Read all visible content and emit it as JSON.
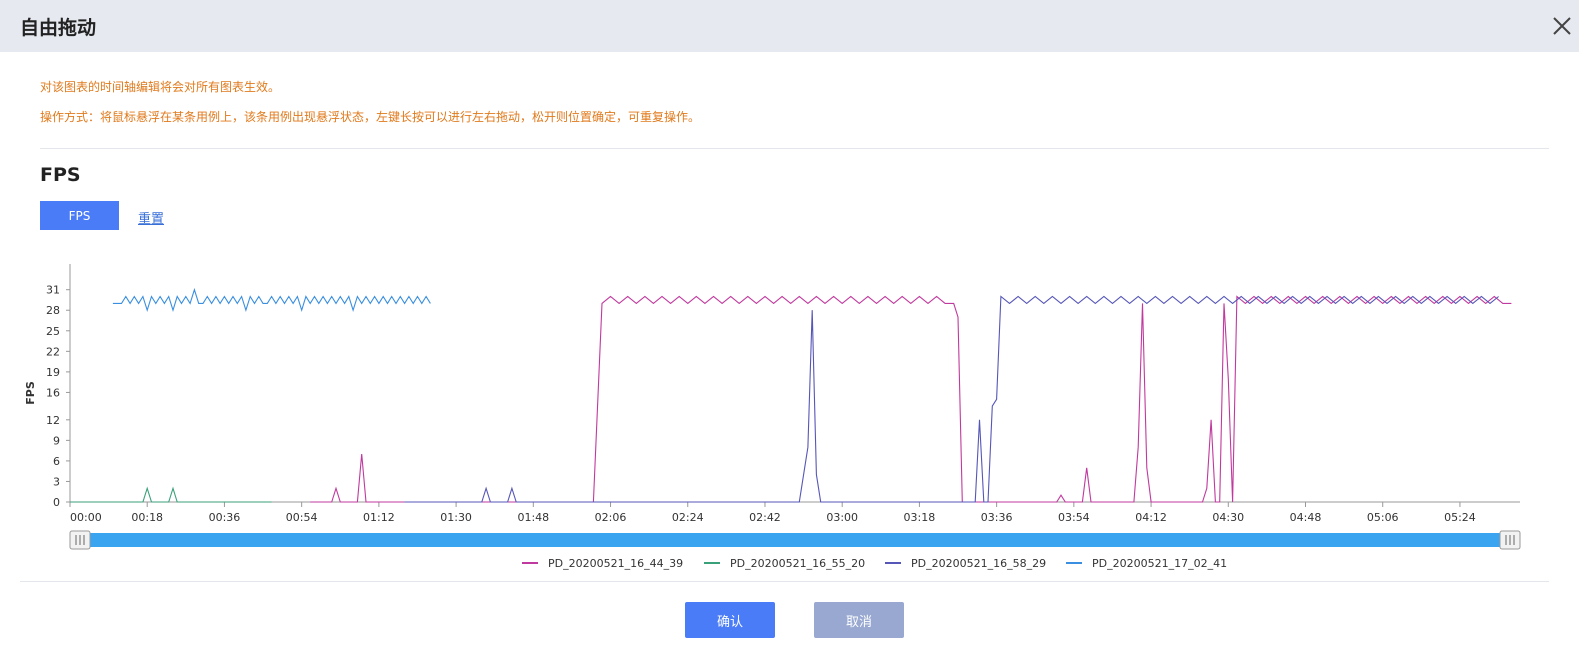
{
  "dialog": {
    "title": "自由拖动",
    "close_icon": "close-icon"
  },
  "notices": {
    "line1": "对该图表的时间轴编辑将会对所有图表生效。",
    "line2": "操作方式：将鼠标悬浮在某条用例上，该条用例出现悬浮状态，左键长按可以进行左右拖动，松开则位置确定，可重复操作。"
  },
  "section": {
    "title": "FPS",
    "tab_label": "FPS",
    "reset_label": "重置"
  },
  "buttons": {
    "confirm": "确认",
    "cancel": "取消"
  },
  "colors": {
    "accent": "#4a7cf7",
    "notice": "#e07a1c",
    "slider": "#3aa4f0"
  },
  "chart_data": {
    "type": "line",
    "ylabel": "FPS",
    "xlabel": "",
    "y_ticks": [
      0,
      3,
      6,
      9,
      12,
      16,
      19,
      22,
      25,
      28,
      31
    ],
    "ylim": [
      0,
      33
    ],
    "x_ticks": [
      "00:00",
      "00:18",
      "00:36",
      "00:54",
      "01:12",
      "01:30",
      "01:48",
      "02:06",
      "02:24",
      "02:42",
      "03:00",
      "03:18",
      "03:36",
      "03:54",
      "04:12",
      "04:30",
      "04:48",
      "05:06",
      "05:24"
    ],
    "xlim": [
      0,
      338
    ],
    "series": [
      {
        "name": "PD_20200521_16_44_39",
        "color": "#c0399e",
        "points": [
          [
            56,
            0
          ],
          [
            61,
            0
          ],
          [
            62,
            2
          ],
          [
            63,
            0
          ],
          [
            67,
            0
          ],
          [
            68,
            7
          ],
          [
            69,
            0
          ],
          [
            122,
            0
          ],
          [
            124,
            29
          ],
          [
            126,
            30
          ],
          [
            128,
            29
          ],
          [
            130,
            30
          ],
          [
            132,
            29
          ],
          [
            134,
            30
          ],
          [
            136,
            29
          ],
          [
            138,
            30
          ],
          [
            140,
            29
          ],
          [
            142,
            30
          ],
          [
            144,
            29
          ],
          [
            146,
            30
          ],
          [
            148,
            29
          ],
          [
            150,
            30
          ],
          [
            152,
            29
          ],
          [
            154,
            30
          ],
          [
            156,
            29
          ],
          [
            158,
            30
          ],
          [
            160,
            29
          ],
          [
            162,
            30
          ],
          [
            164,
            29
          ],
          [
            166,
            30
          ],
          [
            168,
            29
          ],
          [
            170,
            30
          ],
          [
            172,
            29
          ],
          [
            174,
            30
          ],
          [
            176,
            29
          ],
          [
            178,
            30
          ],
          [
            180,
            29
          ],
          [
            182,
            30
          ],
          [
            184,
            29
          ],
          [
            186,
            30
          ],
          [
            188,
            29
          ],
          [
            190,
            30
          ],
          [
            192,
            29
          ],
          [
            194,
            30
          ],
          [
            196,
            29
          ],
          [
            198,
            30
          ],
          [
            200,
            29
          ],
          [
            202,
            30
          ],
          [
            204,
            29
          ],
          [
            206,
            29
          ],
          [
            207,
            27
          ],
          [
            208,
            0
          ],
          [
            230,
            0
          ],
          [
            231,
            1
          ],
          [
            232,
            0
          ],
          [
            236,
            0
          ],
          [
            237,
            5
          ],
          [
            238,
            0
          ],
          [
            248,
            0
          ],
          [
            249,
            8
          ],
          [
            250,
            29
          ],
          [
            251,
            5
          ],
          [
            252,
            0
          ],
          [
            264,
            0
          ],
          [
            265,
            2
          ],
          [
            266,
            12
          ],
          [
            267,
            0
          ],
          [
            268,
            0
          ],
          [
            269,
            29
          ],
          [
            270,
            18
          ],
          [
            271,
            0
          ],
          [
            272,
            30
          ],
          [
            274,
            29
          ],
          [
            276,
            30
          ],
          [
            278,
            29
          ],
          [
            280,
            30
          ],
          [
            282,
            29
          ],
          [
            284,
            30
          ],
          [
            286,
            29
          ],
          [
            288,
            30
          ],
          [
            290,
            29
          ],
          [
            292,
            30
          ],
          [
            294,
            29
          ],
          [
            296,
            30
          ],
          [
            298,
            29
          ],
          [
            300,
            30
          ],
          [
            302,
            29
          ],
          [
            304,
            30
          ],
          [
            306,
            29
          ],
          [
            308,
            30
          ],
          [
            310,
            29
          ],
          [
            312,
            30
          ],
          [
            314,
            29
          ],
          [
            316,
            30
          ],
          [
            318,
            29
          ],
          [
            320,
            30
          ],
          [
            322,
            29
          ],
          [
            324,
            30
          ],
          [
            326,
            29
          ],
          [
            328,
            30
          ],
          [
            330,
            29
          ],
          [
            332,
            30
          ],
          [
            334,
            29
          ],
          [
            336,
            29
          ]
        ]
      },
      {
        "name": "PD_20200521_16_55_20",
        "color": "#3aa07a",
        "points": [
          [
            0,
            0
          ],
          [
            17,
            0
          ],
          [
            18,
            2
          ],
          [
            19,
            0
          ],
          [
            23,
            0
          ],
          [
            24,
            2
          ],
          [
            25,
            0
          ],
          [
            47,
            0
          ]
        ]
      },
      {
        "name": "PD_20200521_16_58_29",
        "color": "#5656b8",
        "points": [
          [
            78,
            0
          ],
          [
            96,
            0
          ],
          [
            97,
            2
          ],
          [
            98,
            0
          ],
          [
            102,
            0
          ],
          [
            103,
            2
          ],
          [
            104,
            0
          ],
          [
            170,
            0
          ],
          [
            172,
            8
          ],
          [
            173,
            28
          ],
          [
            174,
            4
          ],
          [
            175,
            0
          ],
          [
            211,
            0
          ],
          [
            212,
            12
          ],
          [
            213,
            0
          ],
          [
            214,
            0
          ],
          [
            215,
            14
          ],
          [
            216,
            15
          ],
          [
            217,
            30
          ],
          [
            219,
            29
          ],
          [
            221,
            30
          ],
          [
            223,
            29
          ],
          [
            225,
            30
          ],
          [
            227,
            29
          ],
          [
            229,
            30
          ],
          [
            231,
            29
          ],
          [
            233,
            30
          ],
          [
            235,
            29
          ],
          [
            237,
            30
          ],
          [
            239,
            29
          ],
          [
            241,
            30
          ],
          [
            243,
            29
          ],
          [
            245,
            30
          ],
          [
            247,
            29
          ],
          [
            249,
            30
          ],
          [
            251,
            29
          ],
          [
            253,
            30
          ],
          [
            255,
            29
          ],
          [
            257,
            30
          ],
          [
            259,
            29
          ],
          [
            261,
            30
          ],
          [
            263,
            29
          ],
          [
            265,
            30
          ],
          [
            267,
            29
          ],
          [
            269,
            30
          ],
          [
            271,
            29
          ],
          [
            273,
            30
          ],
          [
            275,
            29
          ],
          [
            277,
            30
          ],
          [
            279,
            29
          ],
          [
            281,
            30
          ],
          [
            283,
            29
          ],
          [
            285,
            30
          ],
          [
            287,
            29
          ],
          [
            289,
            30
          ],
          [
            291,
            29
          ],
          [
            293,
            30
          ],
          [
            295,
            29
          ],
          [
            297,
            30
          ],
          [
            299,
            29
          ],
          [
            301,
            30
          ],
          [
            303,
            29
          ],
          [
            305,
            30
          ],
          [
            307,
            29
          ],
          [
            309,
            30
          ],
          [
            311,
            29
          ],
          [
            313,
            30
          ],
          [
            315,
            29
          ],
          [
            317,
            30
          ],
          [
            319,
            29
          ],
          [
            321,
            30
          ],
          [
            323,
            29
          ],
          [
            325,
            30
          ],
          [
            327,
            29
          ],
          [
            329,
            30
          ],
          [
            331,
            29
          ],
          [
            333,
            30
          ]
        ]
      },
      {
        "name": "PD_20200521_17_02_41",
        "color": "#3a8fe0",
        "points": [
          [
            10,
            29
          ],
          [
            12,
            29
          ],
          [
            13,
            30
          ],
          [
            14,
            29
          ],
          [
            15,
            30
          ],
          [
            16,
            29
          ],
          [
            17,
            30
          ],
          [
            18,
            28
          ],
          [
            19,
            30
          ],
          [
            20,
            29
          ],
          [
            21,
            30
          ],
          [
            22,
            29
          ],
          [
            23,
            30
          ],
          [
            24,
            28
          ],
          [
            25,
            30
          ],
          [
            26,
            29
          ],
          [
            27,
            30
          ],
          [
            28,
            29
          ],
          [
            29,
            31
          ],
          [
            30,
            29
          ],
          [
            31,
            29
          ],
          [
            32,
            30
          ],
          [
            33,
            29
          ],
          [
            34,
            30
          ],
          [
            35,
            29
          ],
          [
            36,
            30
          ],
          [
            37,
            29
          ],
          [
            38,
            30
          ],
          [
            39,
            29
          ],
          [
            40,
            30
          ],
          [
            41,
            28
          ],
          [
            42,
            30
          ],
          [
            43,
            29
          ],
          [
            44,
            30
          ],
          [
            45,
            29
          ],
          [
            46,
            29
          ],
          [
            47,
            30
          ],
          [
            48,
            29
          ],
          [
            49,
            30
          ],
          [
            50,
            29
          ],
          [
            51,
            30
          ],
          [
            52,
            29
          ],
          [
            53,
            30
          ],
          [
            54,
            28
          ],
          [
            55,
            30
          ],
          [
            56,
            29
          ],
          [
            57,
            30
          ],
          [
            58,
            29
          ],
          [
            59,
            30
          ],
          [
            60,
            29
          ],
          [
            61,
            30
          ],
          [
            62,
            29
          ],
          [
            63,
            30
          ],
          [
            64,
            29
          ],
          [
            65,
            30
          ],
          [
            66,
            28
          ],
          [
            67,
            30
          ],
          [
            68,
            29
          ],
          [
            69,
            30
          ],
          [
            70,
            29
          ],
          [
            71,
            30
          ],
          [
            72,
            29
          ],
          [
            73,
            30
          ],
          [
            74,
            29
          ],
          [
            75,
            30
          ],
          [
            76,
            29
          ],
          [
            77,
            30
          ],
          [
            78,
            29
          ],
          [
            79,
            30
          ],
          [
            80,
            29
          ],
          [
            81,
            30
          ],
          [
            82,
            29
          ],
          [
            83,
            30
          ],
          [
            84,
            29
          ]
        ]
      }
    ],
    "legend_position": "bottom",
    "grid": false
  }
}
